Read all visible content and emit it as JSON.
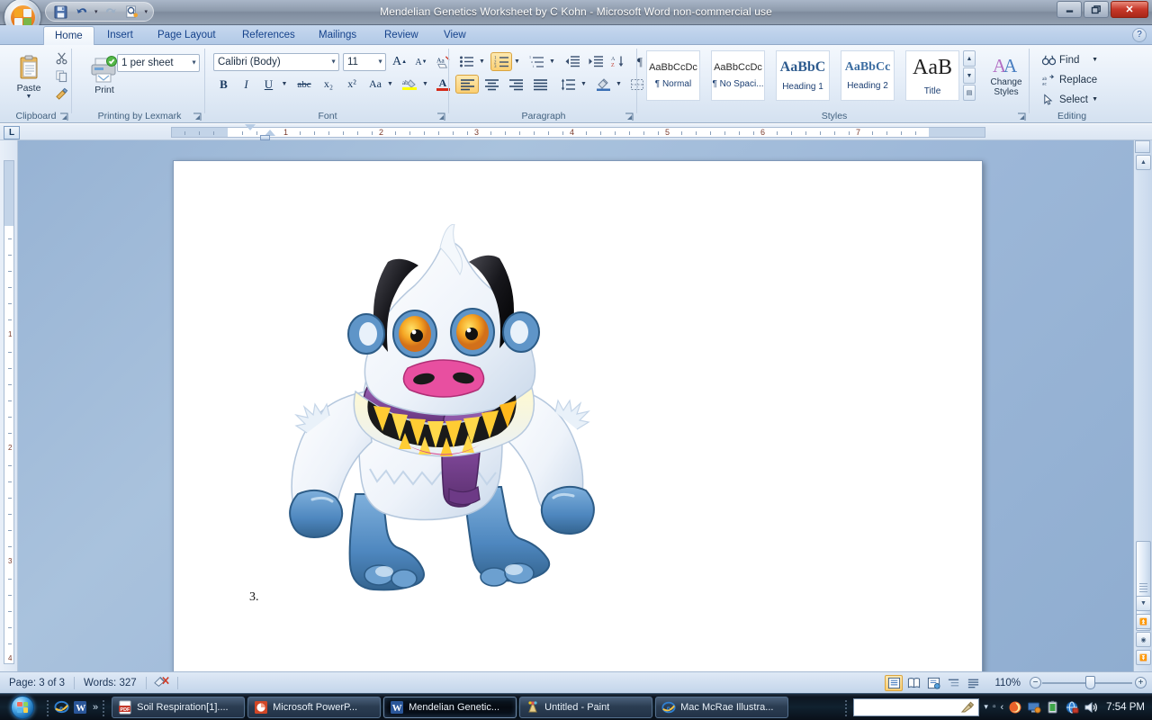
{
  "window": {
    "title": "Mendelian Genetics Worksheet by C Kohn - Microsoft Word non-commercial use",
    "minimize_label": "—",
    "restore_label": "❐",
    "close_label": "✕",
    "help_label": "?"
  },
  "quick_access": {
    "items": [
      {
        "name": "save-icon",
        "label": "Save"
      },
      {
        "name": "undo-icon",
        "label": "Undo"
      },
      {
        "name": "redo-icon",
        "label": "Redo"
      },
      {
        "name": "print-preview-icon",
        "label": "Print Preview"
      },
      {
        "name": "customize-qat-icon",
        "label": "Customize Quick Access Toolbar"
      }
    ]
  },
  "ribbon": {
    "tabs": [
      {
        "label": "Home",
        "active": true
      },
      {
        "label": "Insert",
        "active": false
      },
      {
        "label": "Page Layout",
        "active": false
      },
      {
        "label": "References",
        "active": false
      },
      {
        "label": "Mailings",
        "active": false
      },
      {
        "label": "Review",
        "active": false
      },
      {
        "label": "View",
        "active": false
      }
    ],
    "groups": {
      "clipboard": {
        "label": "Clipboard",
        "paste_label": "Paste",
        "cut_label": "Cut",
        "copy_label": "Copy",
        "format_painter_label": "Format Painter"
      },
      "printing": {
        "label": "Printing by Lexmark",
        "print_label": "Print",
        "sheets_value": "1 per sheet"
      },
      "font": {
        "label": "Font",
        "font_name": "Calibri (Body)",
        "font_size": "11",
        "grow_label": "A",
        "shrink_label": "A",
        "clear_formatting_label": "Aa",
        "bold_label": "B",
        "italic_label": "I",
        "underline_label": "U",
        "strikethrough_label": "abc",
        "subscript_label": "x₂",
        "superscript_label": "x²",
        "change_case_label": "Aa",
        "highlight_label": "ab",
        "font_color_label": "A"
      },
      "paragraph": {
        "label": "Paragraph",
        "bullets_label": "Bullets",
        "numbering_label": "Numbering",
        "multilevel_label": "Multilevel List",
        "decrease_indent_label": "Decrease Indent",
        "increase_indent_label": "Increase Indent",
        "sort_label": "Sort",
        "show_marks_label": "¶",
        "align_left_label": "Align Left",
        "center_label": "Center",
        "align_right_label": "Align Right",
        "justify_label": "Justify",
        "line_spacing_label": "Line Spacing",
        "shading_label": "Shading",
        "borders_label": "Borders"
      },
      "styles": {
        "label": "Styles",
        "items": [
          {
            "preview": "AaBbCcDc",
            "name": "¶ Normal"
          },
          {
            "preview": "AaBbCcDc",
            "name": "¶ No Spaci..."
          },
          {
            "preview": "AaBbC",
            "name": "Heading 1"
          },
          {
            "preview": "AaBbCc",
            "name": "Heading 2"
          },
          {
            "preview": "AaB",
            "name": "Title"
          }
        ],
        "change_styles_line1": "Change",
        "change_styles_line2": "Styles",
        "scroll_up": "▲",
        "scroll_down": "▼",
        "scroll_more": "▤"
      },
      "editing": {
        "label": "Editing",
        "find_label": "Find",
        "replace_label": "Replace",
        "select_label": "Select"
      }
    }
  },
  "ruler": {
    "tab_selector_label": "L",
    "horizontal_numbers": [
      "1",
      "2",
      "3",
      "4",
      "5",
      "6",
      "7"
    ],
    "vertical_numbers": [
      "1",
      "2",
      "3",
      "4"
    ]
  },
  "document": {
    "body_text": "3.",
    "image_alt": "yeti-monster-illustration"
  },
  "status_bar": {
    "page_label": "Page: 3 of 3",
    "words_label": "Words: 327",
    "proofing_icon": "spell-check-icon",
    "views": [
      {
        "name": "print-layout-view-button",
        "active": true
      },
      {
        "name": "full-screen-reading-view-button",
        "active": false
      },
      {
        "name": "web-layout-view-button",
        "active": false
      },
      {
        "name": "outline-view-button",
        "active": false
      },
      {
        "name": "draft-view-button",
        "active": false
      }
    ],
    "zoom_value": "110%",
    "zoom_out_label": "−",
    "zoom_in_label": "+"
  },
  "taskbar": {
    "start_label": "Start",
    "quick_launch": [
      {
        "name": "internet-explorer-icon",
        "label": "Internet Explorer"
      },
      {
        "name": "word-icon",
        "label": "Microsoft Word"
      }
    ],
    "quick_launch_more": "»",
    "tasks": [
      {
        "label": "Soil Respiration[1]....",
        "icon": "pdf-icon",
        "active": false
      },
      {
        "label": "Microsoft PowerP...",
        "icon": "powerpoint-icon",
        "active": false
      },
      {
        "label": "Mendelian Genetic...",
        "icon": "word-icon",
        "active": true
      },
      {
        "label": "Untitled - Paint",
        "icon": "paint-icon",
        "active": false
      },
      {
        "label": "Mac McRae Illustra...",
        "icon": "internet-explorer-icon",
        "active": false
      }
    ],
    "tray": [
      {
        "name": "show-hidden-icons-arrow",
        "label": "▾"
      },
      {
        "name": "tray-square-icon",
        "label": "▫"
      },
      {
        "name": "tray-chevron-icon",
        "label": "‹"
      },
      {
        "name": "spiral-app-icon",
        "label": ""
      },
      {
        "name": "display-app-icon",
        "label": ""
      },
      {
        "name": "battery-icon",
        "label": ""
      },
      {
        "name": "network-icon",
        "label": ""
      },
      {
        "name": "volume-icon",
        "label": ""
      }
    ],
    "clock": "7:54 PM"
  },
  "colors": {
    "title_bar": "#8d9aab",
    "ribbon_tab_strip": "#b2c9e6",
    "desktop_backdrop": "#9cb7d8",
    "accent_blue": "#15428b",
    "taskbar": "#0d1520",
    "close_button": "#c7382a",
    "scarf_purple": "#7b4b96",
    "yeti_body": "#f2f6fb",
    "yeti_limb_blue": "#5b92c7",
    "tooth_yellow": "#ffcc33",
    "nose_pink": "#e84fa0"
  }
}
